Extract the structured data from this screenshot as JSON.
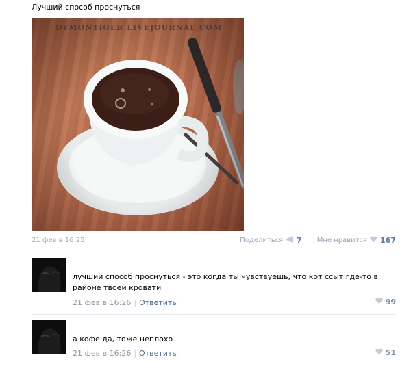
{
  "post": {
    "text": "Лучший способ проснуться",
    "watermark": "DYMONTIGER.LIVEJOURNAL.COM",
    "date": "21 фев в 16:25",
    "share_label": "Поделиться",
    "share_count": "7",
    "like_label": "Мне нравится",
    "like_count": "167"
  },
  "comments": [
    {
      "text": "лучший способ проснуться - это когда ты чувствуешь, что кот ссыт где-то в районе твоей кровати",
      "date": "21 фев в 16:26",
      "reply_label": "Ответить",
      "likes": "99"
    },
    {
      "text": "а кофе да, тоже неплохо",
      "date": "21 фев в 16:26",
      "reply_label": "Ответить",
      "likes": "51"
    }
  ],
  "icons": {
    "share": "megaphone-icon",
    "like": "heart-icon"
  },
  "colors": {
    "link": "#4d6a8f",
    "muted": "#a0a9b4",
    "count": "#5f7c9d"
  }
}
